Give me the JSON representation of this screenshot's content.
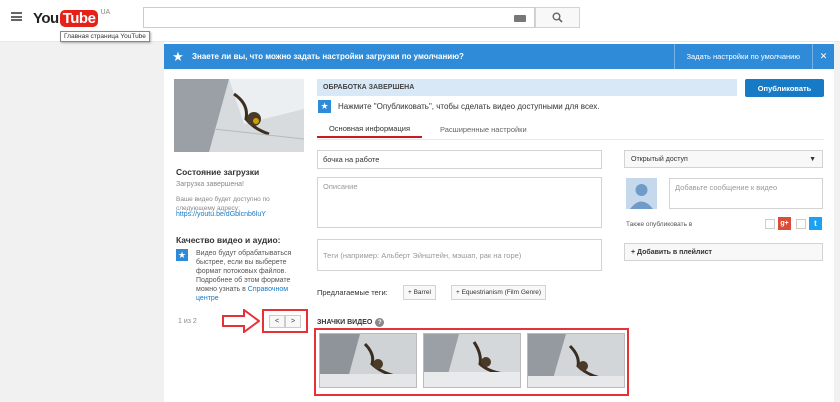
{
  "header": {
    "logo_you": "You",
    "logo_tube": "Tube",
    "logo_region": "UA",
    "logo_tooltip": "Главная страница YouTube",
    "search_placeholder": ""
  },
  "banner": {
    "text": "Знаете ли вы, что можно задать настройки загрузки по умолчанию?",
    "link": "Задать настройки по умолчанию",
    "close": "✕"
  },
  "left": {
    "status_title": "Состояние загрузки",
    "status_sub": "Загрузка завершена!",
    "status_info": "Ваше видео будет доступно по следующему адресу:",
    "video_link": "https://youtu.be/dGblcnb6luY",
    "quality_title": "Качество видео и аудио:",
    "quality_text": "Видео будут обрабатываться быстрее, если вы выберете формат потоковых файлов. Подробнее об этом формате можно узнать в ",
    "quality_link": "Справочном центре",
    "pager_text": "1 из 2",
    "pager_prev": "<",
    "pager_next": ">"
  },
  "main": {
    "processing": "ОБРАБОТКА ЗАВЕРШЕНА",
    "publish_label": "Опубликовать",
    "notice": "Нажмите \"Опубликовать\", чтобы сделать видео доступными для всех.",
    "tab_basic": "Основная информация",
    "tab_advanced": "Расширенные настройки",
    "title_value": "бочка на работе",
    "desc_placeholder": "Описание",
    "tags_placeholder": "Теги (например: Альберт Эйнштейн, мэшап, рак на горе)",
    "suggested_label": "Предлагаемые теги:",
    "suggested_tags": [
      "+ Barrel",
      "+ Equestrianism (Film Genre)"
    ],
    "thumbs_title": "ЗНАЧКИ ВИДЕО",
    "help": "?"
  },
  "right": {
    "privacy": "Открытый доступ",
    "privacy_arrow": "▼",
    "msg_placeholder": "Добавьте сообщение к видео",
    "also_publish": "Также опубликовать в",
    "gplus": "g+",
    "twitter": "t",
    "playlist": "+ Добавить в плейлист"
  },
  "colors": {
    "accent_blue": "#167ac6",
    "banner_blue": "#2f8bd8",
    "highlight_red": "#e53238"
  }
}
